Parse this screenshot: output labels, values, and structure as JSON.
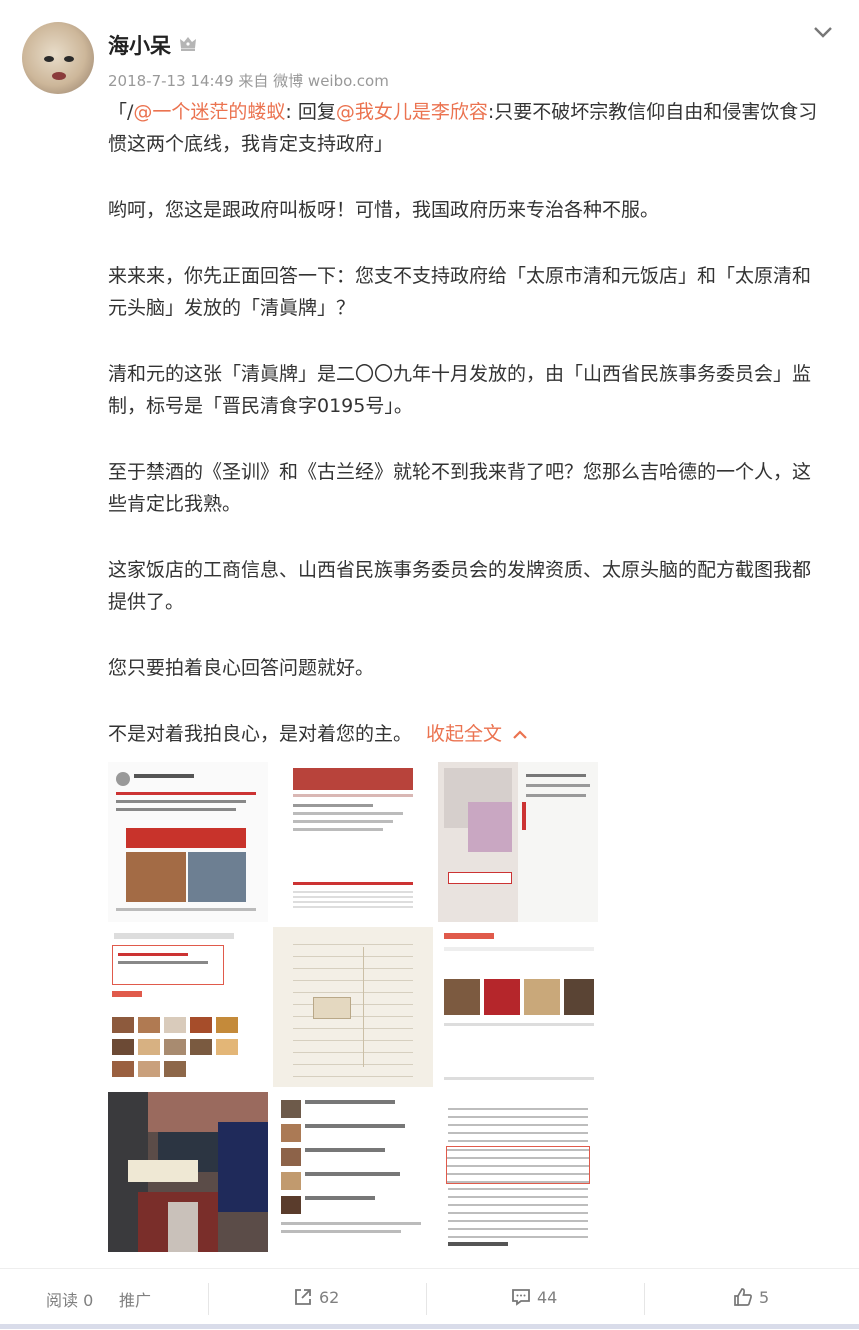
{
  "post": {
    "username": "海小呆",
    "meta": "2018-7-13 14:49 来自 微博 weibo.com",
    "quote": {
      "prefix": "「/",
      "mention1": "@一个迷茫的蝼蚁",
      "mid": ": 回复",
      "mention2": "@我女儿是李欣容",
      "rest": ":只要不破坏宗教信仰自由和侵害饮食习惯这两个底线，我肯定支持政府」"
    },
    "paragraphs": [
      "哟呵，您这是跟政府叫板呀！可惜，我国政府历来专治各种不服。",
      "来来来，你先正面回答一下：您支不支持政府给「太原市清和元饭店」和「太原清和元头脑」发放的「清眞牌」？",
      "清和元的这张「清眞牌」是二〇〇九年十月发放的，由「山西省民族事务委员会」监制，标号是「晋民清食字0195号」。",
      "至于禁酒的《圣训》和《古兰经》就轮不到我来背了吧？您那么吉哈德的一个人，这些肯定比我熟。",
      "这家饭店的工商信息、山西省民族事务委员会的发牌资质、太原头脑的配方截图我都提供了。",
      "您只要拍着良心回答问题就好。"
    ],
    "last_paragraph": "不是对着我拍良心，是对着您的主。",
    "collapse_label": "收起全文",
    "images": [
      {
        "name": "weibo-screenshot"
      },
      {
        "name": "ethnic-affairs-site-screenshot"
      },
      {
        "name": "certificate-photo"
      },
      {
        "name": "business-info-screenshot"
      },
      {
        "name": "registry-document"
      },
      {
        "name": "food-photos-screenshot"
      },
      {
        "name": "restaurant-storefront-photo"
      },
      {
        "name": "recipe-list-screenshot"
      },
      {
        "name": "book-page-scan"
      }
    ]
  },
  "footer": {
    "reads_label": "阅读 0",
    "promote_label": "推广",
    "share_count": "62",
    "comment_count": "44",
    "like_count": "5"
  },
  "colors": {
    "accent": "#eb7350",
    "text": "#333333",
    "muted": "#999999"
  }
}
